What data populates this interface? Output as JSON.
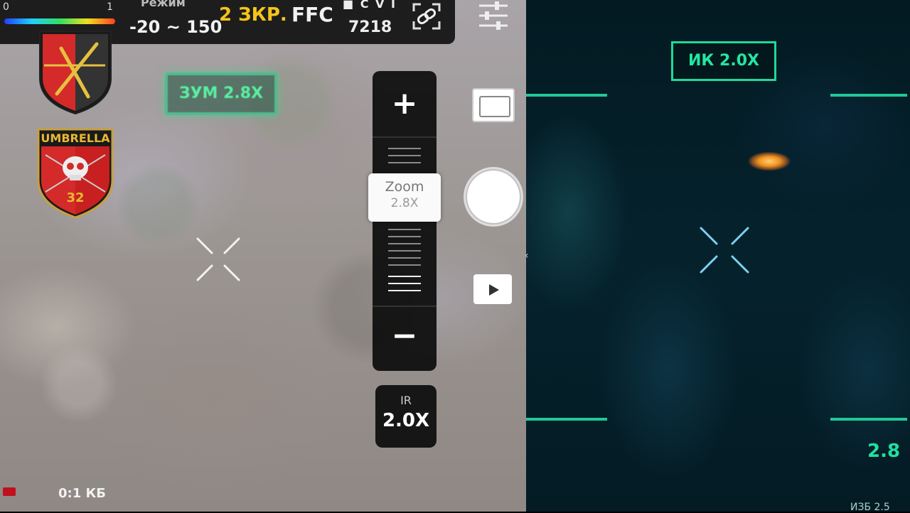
{
  "header": {
    "scale_min": "0",
    "scale_max": "1",
    "mode_label": "Режим",
    "range_value": "-20 ~ 150",
    "zoom_level": "2 ЗКР.",
    "ffc_label": "FFC",
    "rec_row": "■ C V I",
    "counter_value": "7218"
  },
  "icons": {
    "link": "link-icon",
    "settings": "sliders-icon",
    "emblem_1": "red-black-shield-emblem",
    "emblem_2": "umbrella-skull-shield-emblem"
  },
  "emblems": {
    "umbrella_text": "UMBRELLA",
    "umbrella_number": "32"
  },
  "left_view": {
    "zoom_tag": "ЗУМ 2.8Х",
    "bottom_text": "0:1 КБ"
  },
  "zoom_control": {
    "plus_label": "+",
    "minus_label": "−",
    "thumb_label": "Zoom",
    "thumb_value": "2.8X"
  },
  "ir_button": {
    "label": "IR",
    "value": "2.0X"
  },
  "right_view": {
    "ir_tag": "ИК 2.0Х",
    "zoom_readout": "2.8",
    "bottom_text": "ИЗБ 2.5"
  },
  "colors": {
    "accent_green": "#21c895",
    "zoom_yellow": "#f5c518",
    "target_orange": "#f09020"
  }
}
